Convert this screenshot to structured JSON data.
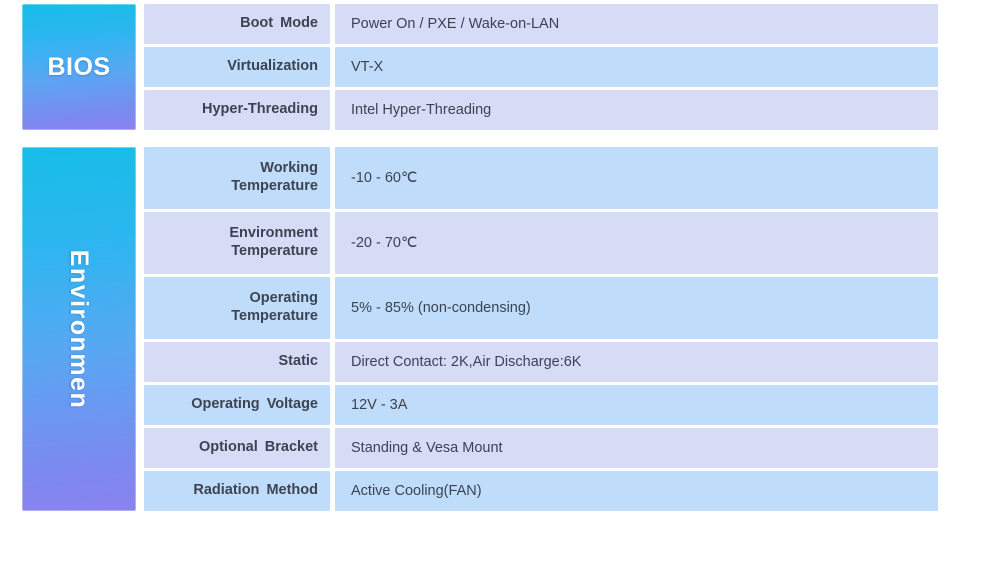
{
  "page": {
    "background": "#ffffff",
    "accent_gradient_start": "#17bde8",
    "accent_gradient_end": "#8a82ef",
    "row_tint_lavender": "#d6dcf5",
    "row_tint_blue": "#bfdcfa",
    "text_color": "#3c4352"
  },
  "sections": [
    {
      "id": "bios",
      "category": "BIOS",
      "orientation": "horizontal",
      "rows": [
        {
          "label": "Boot  Mode",
          "label_lines": [
            "Boot  Mode"
          ],
          "value": "Power On / PXE / Wake-on-LAN",
          "tint": "lavender"
        },
        {
          "label": "Virtualization",
          "label_lines": [
            "Virtualization"
          ],
          "value": "VT-X",
          "tint": "blue"
        },
        {
          "label": "Hyper-Threading",
          "label_lines": [
            "Hyper-Threading"
          ],
          "value": "Intel Hyper-Threading",
          "tint": "lavender"
        }
      ]
    },
    {
      "id": "environment",
      "category": "Environmen",
      "orientation": "vertical",
      "rows": [
        {
          "label": "Working Temperature",
          "label_lines": [
            "Working",
            "Temperature"
          ],
          "value": "-10 - 60℃",
          "tint": "blue"
        },
        {
          "label": "Environment Temperature",
          "label_lines": [
            "Environment",
            "Temperature"
          ],
          "value": "-20 - 70℃",
          "tint": "lavender"
        },
        {
          "label": "Operating Temperature",
          "label_lines": [
            "Operating",
            "Temperature"
          ],
          "value": "5% - 85% (non-condensing)",
          "tint": "blue"
        },
        {
          "label": "Static",
          "label_lines": [
            "Static"
          ],
          "value": "Direct Contact: 2K,Air Discharge:6K",
          "tint": "lavender"
        },
        {
          "label": "Operating  Voltage",
          "label_lines": [
            "Operating  Voltage"
          ],
          "value": "12V - 3A",
          "tint": "blue"
        },
        {
          "label": "Optional  Bracket",
          "label_lines": [
            "Optional  Bracket"
          ],
          "value": "Standing & Vesa Mount",
          "tint": "lavender"
        },
        {
          "label": "Radiation  Method",
          "label_lines": [
            "Radiation  Method"
          ],
          "value": "Active Cooling(FAN)",
          "tint": "blue"
        }
      ]
    }
  ]
}
